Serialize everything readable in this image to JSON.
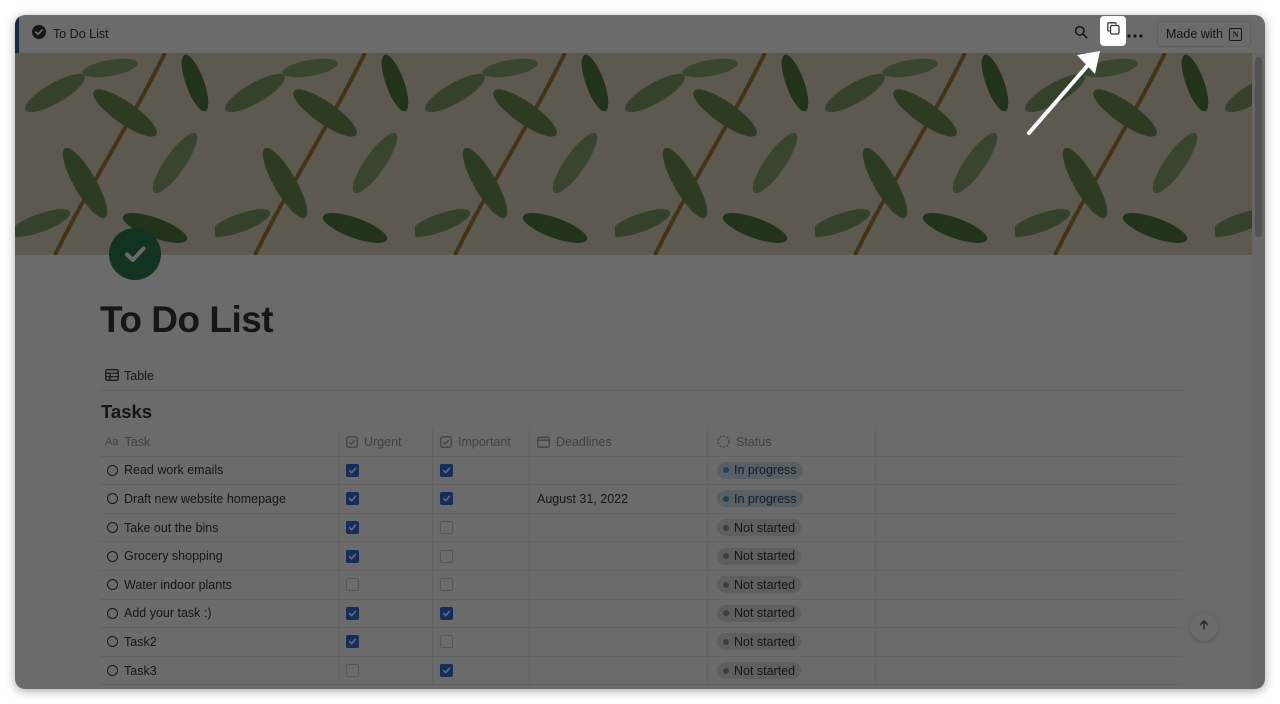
{
  "window": {
    "title": "To Do List",
    "made_with_label": "Made with",
    "icons": [
      "check-circle-icon",
      "search-icon",
      "duplicate-icon",
      "more-icon",
      "notion-logo"
    ]
  },
  "page": {
    "title": "To Do List",
    "view_tab_label": "Table",
    "database_title": "Tasks"
  },
  "table": {
    "columns": [
      {
        "label": "Task",
        "icon": "text-aa-icon"
      },
      {
        "label": "Urgent",
        "icon": "checkbox-icon"
      },
      {
        "label": "Important",
        "icon": "checkbox-icon"
      },
      {
        "label": "Deadlines",
        "icon": "calendar-icon"
      },
      {
        "label": "Status",
        "icon": "status-icon"
      }
    ],
    "rows": [
      {
        "task": "Read work emails",
        "urgent": true,
        "important": true,
        "deadline": "",
        "status": "In progress"
      },
      {
        "task": "Draft new website homepage",
        "urgent": true,
        "important": true,
        "deadline": "August 31, 2022",
        "status": "In progress"
      },
      {
        "task": "Take out the bins",
        "urgent": true,
        "important": false,
        "deadline": "",
        "status": "Not started"
      },
      {
        "task": "Grocery shopping",
        "urgent": true,
        "important": false,
        "deadline": "",
        "status": "Not started"
      },
      {
        "task": "Water indoor plants",
        "urgent": false,
        "important": false,
        "deadline": "",
        "status": "Not started"
      },
      {
        "task": "Add your task :)",
        "urgent": true,
        "important": true,
        "deadline": "",
        "status": "Not started"
      },
      {
        "task": "Task2",
        "urgent": true,
        "important": false,
        "deadline": "",
        "status": "Not started"
      },
      {
        "task": "Task3",
        "urgent": false,
        "important": true,
        "deadline": "",
        "status": "Not started"
      }
    ]
  },
  "colors": {
    "accent_bar": "#2f5fa8",
    "page_icon": "#2b7a4b",
    "checkbox_checked": "#2e6fd6",
    "in_progress_pill": "#d3e5ef",
    "not_started_pill": "#e3e2e0",
    "overlay": "#000000"
  }
}
